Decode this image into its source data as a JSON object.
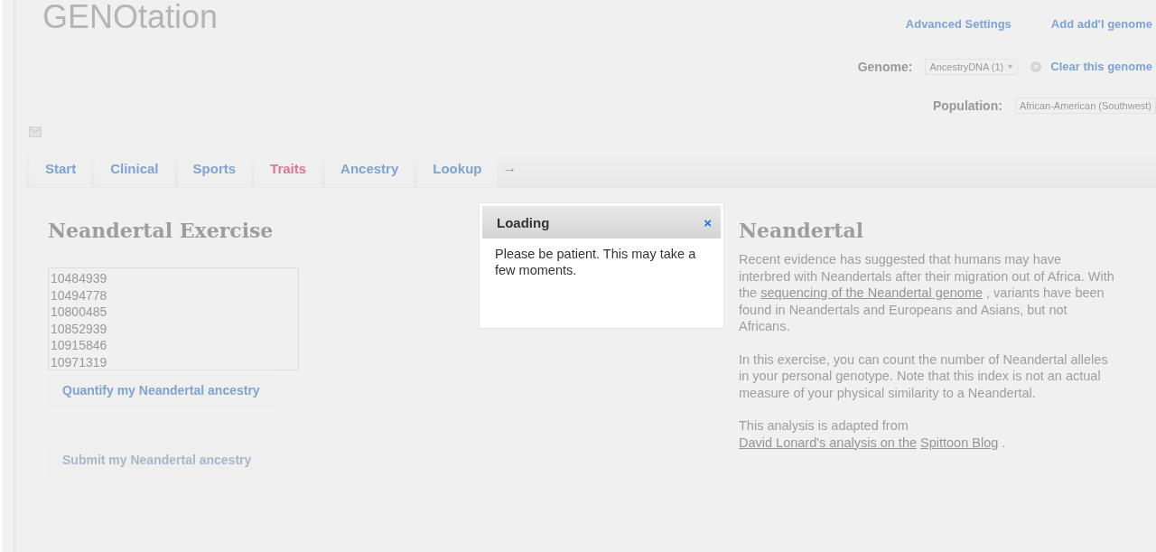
{
  "header": {
    "logo": "GENOtation",
    "links": [
      "Advanced Settings",
      "Add add'l genome"
    ],
    "genome": {
      "label": "Genome:",
      "value": "AncestryDNA (1)",
      "clear": "Clear this genome"
    },
    "population": {
      "label": "Population:",
      "value": "African-American (Southwest)"
    }
  },
  "tabs": [
    {
      "label": "Start",
      "selected": false
    },
    {
      "label": "Clinical",
      "selected": false
    },
    {
      "label": "Sports",
      "selected": false
    },
    {
      "label": "Traits",
      "selected": true
    },
    {
      "label": "Ancestry",
      "selected": false
    },
    {
      "label": "Lookup",
      "selected": false
    }
  ],
  "tab_arrow": "→",
  "exercise": {
    "title": "Neandertal Exercise",
    "snps": [
      "10484939",
      "10494778",
      "10800485",
      "10852939",
      "10915846",
      "10971319"
    ],
    "buttons": [
      {
        "label": "Quantify my Neandertal ancestry",
        "disabled": false
      },
      {
        "label": "Submit my Neandertal ancestry",
        "disabled": true
      }
    ]
  },
  "info": {
    "title": "Neandertal",
    "paragraphs": [
      [
        {
          "kind": "text",
          "text": "Recent evidence has suggested that humans may have interbred with Neandertals after their migration out of Africa. With the "
        },
        {
          "kind": "link",
          "text": "sequencing of the Neandertal genome"
        },
        {
          "kind": "text",
          "text": ", variants have been found in Neandertals and Europeans and Asians, but not Africans."
        }
      ],
      [
        {
          "kind": "text",
          "text": "In this exercise, you can count the number of Neandertal alleles in your personal genotype. Note that this index is not an actual measure of your physical similarity to a Neandertal."
        }
      ],
      [
        {
          "kind": "text",
          "text": "This analysis is adapted from "
        },
        {
          "kind": "link",
          "text": "David Lonard's analysis on the"
        },
        {
          "kind": "link",
          "text": "Spittoon Blog"
        },
        {
          "kind": "text",
          "text": "."
        }
      ]
    ]
  },
  "dialog": {
    "title": "Loading",
    "close": "×",
    "message": "Please be patient. This may take a few moments."
  }
}
